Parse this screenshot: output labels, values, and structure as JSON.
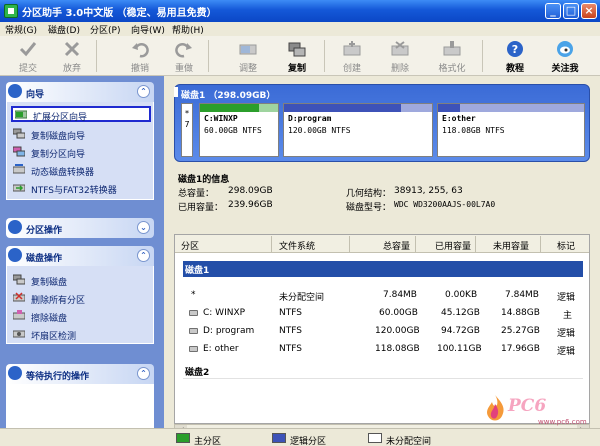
{
  "window": {
    "title": "分区助手 3.0中文版 （稳定、易用且免费）",
    "controls": [
      "_",
      "□",
      "×"
    ]
  },
  "menu": [
    "常规(G)",
    "磁盘(D)",
    "分区(P)",
    "向导(W)",
    "帮助(H)"
  ],
  "toolbar": [
    {
      "label": "提交",
      "icon": "check-icon",
      "active": false
    },
    {
      "label": "放弃",
      "icon": "discard-icon",
      "active": false
    },
    {
      "label": "撤销",
      "icon": "undo-icon",
      "active": false
    },
    {
      "label": "重做",
      "icon": "redo-icon",
      "active": false
    },
    {
      "label": "调整",
      "icon": "resize-icon",
      "active": false
    },
    {
      "label": "复制",
      "icon": "copy-icon",
      "active": true
    },
    {
      "label": "创建",
      "icon": "create-icon",
      "active": false
    },
    {
      "label": "删除",
      "icon": "delete-icon",
      "active": false
    },
    {
      "label": "格式化",
      "icon": "format-icon",
      "active": false
    },
    {
      "label": "教程",
      "icon": "help-icon",
      "active": true
    },
    {
      "label": "关注我",
      "icon": "follow-icon",
      "active": true
    }
  ],
  "left_panel": {
    "wizard": {
      "title": "向导",
      "items": [
        "扩展分区向导",
        "复制磁盘向导",
        "复制分区向导",
        "动态磁盘转换器",
        "NTFS与FAT32转换器"
      ]
    },
    "partition_ops": {
      "title": "分区操作"
    },
    "disk_ops": {
      "title": "磁盘操作",
      "items": [
        "复制磁盘",
        "删除所有分区",
        "擦除磁盘",
        "坏扇区检测"
      ]
    },
    "pending": {
      "title": "等待执行的操作"
    }
  },
  "disk_map": {
    "title": "磁盘1  （298.09GB）",
    "unallocated_label": "*\n7",
    "partitions": [
      {
        "name": "C:WINXP",
        "size": "60.00GB NTFS",
        "used_fraction": 0.75
      },
      {
        "name": "D:program",
        "size": "120.00GB NTFS",
        "used_fraction": 0.79
      },
      {
        "name": "E:other",
        "size": "118.08GB NTFS",
        "used_fraction": 0.15
      }
    ]
  },
  "disk_info": {
    "title": "磁盘1的信息",
    "total_label": "总容量：",
    "total_value": "298.09GB",
    "used_label": "已用容量：",
    "used_value": "239.96GB",
    "geometry_label": "几何结构：",
    "geometry_value": "38913,  255,  63",
    "model_label": "磁盘型号：",
    "model_value": "WDC WD3200AAJS-00L7A0"
  },
  "table": {
    "headers": [
      "分区",
      "文件系统",
      "总容量",
      "已用容量",
      "未用容量",
      "标记"
    ],
    "disk1_label": "磁盘1",
    "disk2_label": "磁盘2",
    "rows": [
      {
        "name": "*",
        "fs": "未分配空间",
        "total": "7.84MB",
        "used": "0.00KB",
        "free": "7.84MB",
        "flag": "逻辑"
      },
      {
        "name": "C:  WINXP",
        "fs": "NTFS",
        "total": "60.00GB",
        "used": "45.12GB",
        "free": "14.88GB",
        "flag": "主"
      },
      {
        "name": "D:  program",
        "fs": "NTFS",
        "total": "120.00GB",
        "used": "94.72GB",
        "free": "25.27GB",
        "flag": "逻辑"
      },
      {
        "name": "E:  other",
        "fs": "NTFS",
        "total": "118.08GB",
        "used": "100.11GB",
        "free": "17.96GB",
        "flag": "逻辑"
      }
    ]
  },
  "legend": [
    {
      "label": "主分区",
      "color": "#2b9e2b"
    },
    {
      "label": "逻辑分区",
      "color": "#3d52b8"
    },
    {
      "label": "未分配空间",
      "color": "#ffffff"
    }
  ],
  "watermark": {
    "text": "www.pc6.com",
    "logo_text": "PC6"
  },
  "colors": {
    "primary": "#2b9e2b",
    "logical": "#3d52b8",
    "accent": "#234ea8"
  }
}
